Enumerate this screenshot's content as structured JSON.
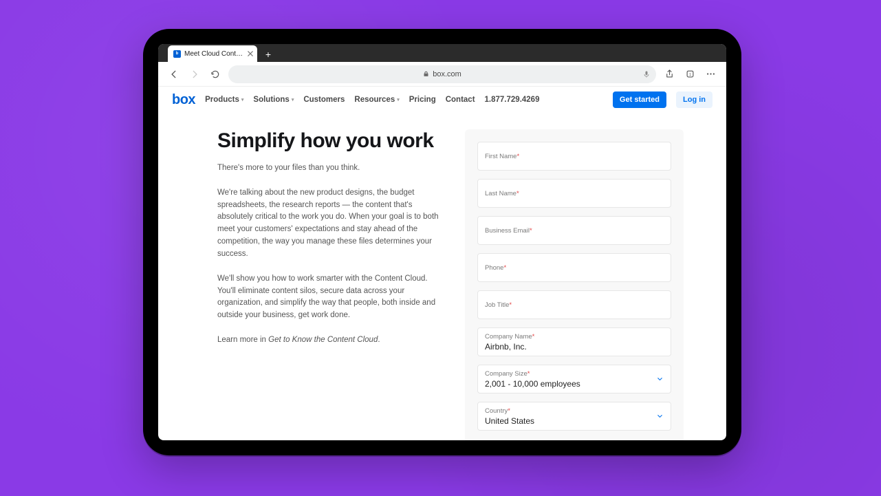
{
  "browser": {
    "tab_title": "Meet Cloud Content Man",
    "url_display": "box.com"
  },
  "nav": {
    "logo": "box",
    "items": [
      "Products",
      "Solutions",
      "Customers",
      "Resources",
      "Pricing",
      "Contact"
    ],
    "phone": "1.877.729.4269",
    "cta_primary": "Get started",
    "cta_secondary": "Log in"
  },
  "content": {
    "heading": "Simplify how you work",
    "subheading": "There's more to your files than you think.",
    "para1": "We're talking about the new product designs, the budget spreadsheets, the research reports — the content that's absolutely critical to the work you do. When your goal is to both meet your customers' expectations and stay ahead of the competition, the way you manage these files determines your success.",
    "para2": "We'll show you how to work smarter with the Content Cloud. You'll eliminate content silos, secure data across your organization, and simplify the way that people, both inside and outside your business, get work done.",
    "learn_prefix": "Learn more in ",
    "learn_em": "Get to Know the Content Cloud",
    "learn_suffix": "."
  },
  "form": {
    "first_name_label": "First Name",
    "last_name_label": "Last Name",
    "email_label": "Business Email",
    "phone_label": "Phone",
    "job_title_label": "Job Title",
    "company_name_label": "Company Name",
    "company_name_value": "Airbnb, Inc.",
    "company_size_label": "Company Size",
    "company_size_value": "2,001 - 10,000 employees",
    "country_label": "Country",
    "country_value": "United States"
  }
}
